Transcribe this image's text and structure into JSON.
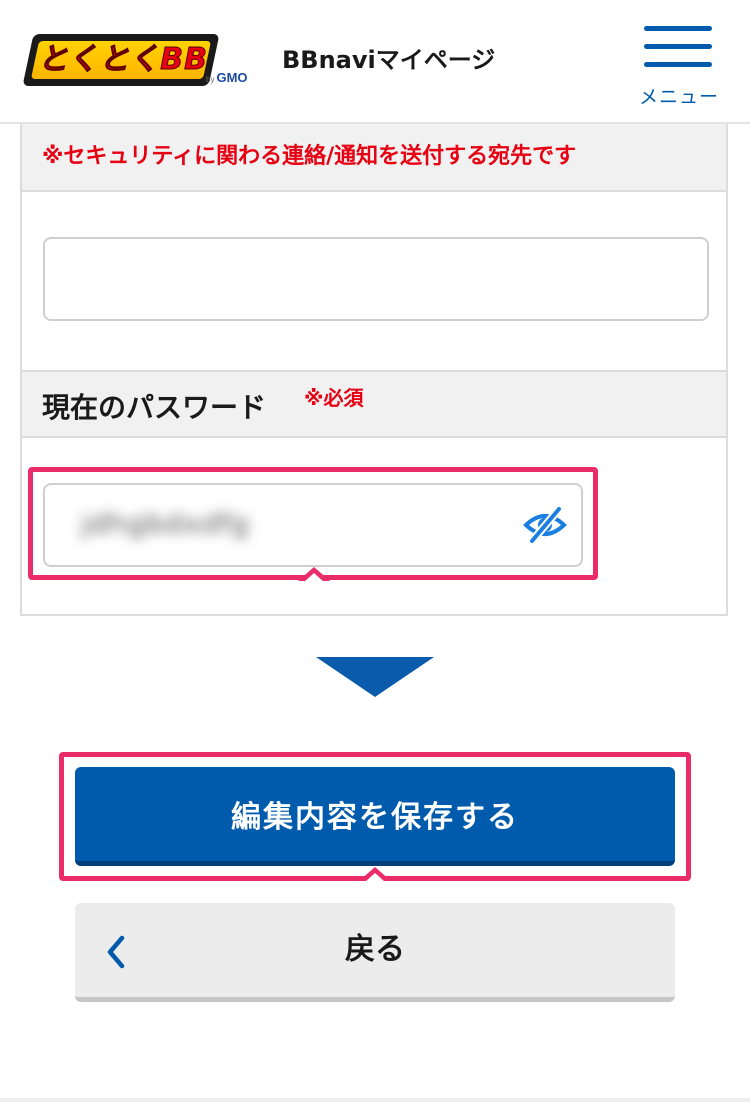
{
  "header": {
    "logo_text": "とくとくBB",
    "logo_by": "by",
    "logo_brand": "GMO",
    "title": "BBnaviマイページ",
    "menu_label": "メニュー"
  },
  "form": {
    "security_note": "※セキュリティに関わる連絡/通知を送付する宛先です",
    "email_value": "",
    "password_label": "現在のパスワード",
    "password_required": "※必須",
    "password_value": "jdhgbdxdfg"
  },
  "actions": {
    "save_label": "編集内容を保存する",
    "back_label": "戻る"
  },
  "colors": {
    "primary": "#005bac",
    "required_red": "#e60012",
    "highlight": "#ea2d68",
    "logo_yellow": "#ffd300"
  },
  "icons": {
    "menu": "hamburger-icon",
    "password_toggle": "eye-slash-icon",
    "back": "chevron-left-icon",
    "flow": "down-triangle-icon"
  }
}
